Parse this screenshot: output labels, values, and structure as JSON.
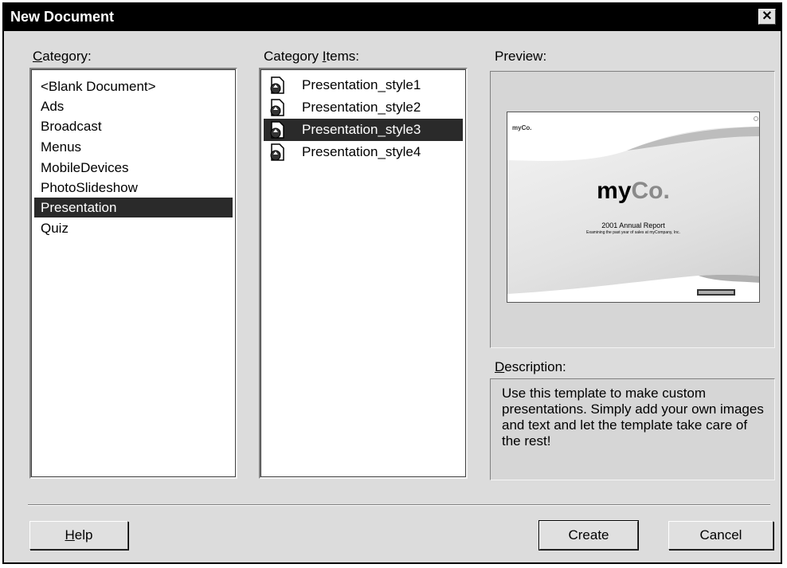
{
  "window": {
    "title": "New Document",
    "close_glyph": "✕"
  },
  "category": {
    "label_first": "C",
    "label_rest": "ategory:",
    "items": [
      "<Blank Document>",
      "Ads",
      "Broadcast",
      "Menus",
      "MobileDevices",
      "PhotoSlideshow",
      "Presentation",
      "Quiz"
    ],
    "selected": "Presentation"
  },
  "category_items": {
    "label_pre": "Category ",
    "label_u": "I",
    "label_post": "tems:",
    "items": [
      "Presentation_style1",
      "Presentation_style2",
      "Presentation_style3",
      "Presentation_style4"
    ],
    "selected": "Presentation_style3"
  },
  "preview": {
    "label": "Preview:",
    "thumb_logo_small": "myCo.",
    "thumb_logo_big_my": "my",
    "thumb_logo_big_co": "Co.",
    "thumb_report": "2001 Annual Report",
    "thumb_sub": "Examining the past year of sales at myCompany, Inc."
  },
  "description": {
    "label_u": "D",
    "label_rest": "escription:",
    "text": "Use this template to make custom presentations. Simply add your own images and text and let the template take care of the rest!"
  },
  "buttons": {
    "help_u": "H",
    "help_rest": "elp",
    "create": "Create",
    "cancel": "Cancel"
  },
  "colors": {
    "selection": "#2a2a2a",
    "dialog_bg": "#dcdcdc",
    "titlebar": "#000000"
  }
}
